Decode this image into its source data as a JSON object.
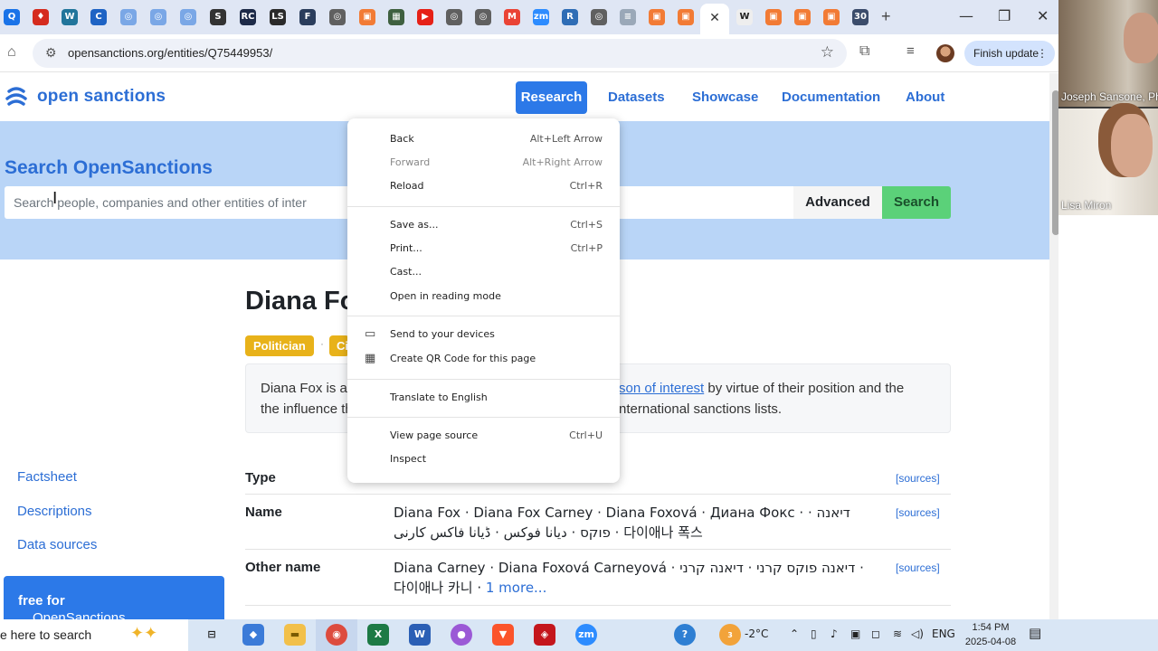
{
  "browser": {
    "tabs": [
      {
        "icon": "search-icon",
        "color": "#1a73e8",
        "glyph": "Q"
      },
      {
        "icon": "maple-leaf-icon",
        "color": "#d52b1e",
        "glyph": "♦"
      },
      {
        "icon": "wordpress-icon",
        "color": "#21759b",
        "glyph": "W"
      },
      {
        "icon": "c-icon",
        "color": "#1e63c4",
        "glyph": "C"
      },
      {
        "icon": "globe-icon",
        "color": "#7aa7e6",
        "glyph": "◎"
      },
      {
        "icon": "globe-icon",
        "color": "#7aa7e6",
        "glyph": "◎"
      },
      {
        "icon": "globe-icon",
        "color": "#7aa7e6",
        "glyph": "◎"
      },
      {
        "icon": "s-icon",
        "color": "#333333",
        "glyph": "S"
      },
      {
        "icon": "rc-icon",
        "color": "#1d2a48",
        "glyph": "RC"
      },
      {
        "icon": "ls-icon",
        "color": "#2a2a2a",
        "glyph": "LS"
      },
      {
        "icon": "f-icon",
        "color": "#2a3d5c",
        "glyph": "F"
      },
      {
        "icon": "globe-icon",
        "color": "#606060",
        "glyph": "◎"
      },
      {
        "icon": "bookmark-icon",
        "color": "#f27b35",
        "glyph": "▣"
      },
      {
        "icon": "image-icon",
        "color": "#3f6040",
        "glyph": "▦"
      },
      {
        "icon": "youtube-icon",
        "color": "#e62117",
        "glyph": "▶"
      },
      {
        "icon": "globe-icon",
        "color": "#606060",
        "glyph": "◎"
      },
      {
        "icon": "globe-icon",
        "color": "#606060",
        "glyph": "◎"
      },
      {
        "icon": "gmail-icon",
        "color": "#ea4335",
        "glyph": "M"
      },
      {
        "icon": "zoom-icon",
        "color": "#2d8cff",
        "glyph": "zm"
      },
      {
        "icon": "r-icon",
        "color": "#2f6db5",
        "glyph": "R"
      },
      {
        "icon": "globe-icon",
        "color": "#606060",
        "glyph": "◎"
      },
      {
        "icon": "news-icon",
        "color": "#9aa8b8",
        "glyph": "≡"
      },
      {
        "icon": "bookmark-icon",
        "color": "#f27b35",
        "glyph": "▣"
      },
      {
        "icon": "bookmark-icon",
        "color": "#f27b35",
        "glyph": "▣"
      }
    ],
    "active_tab_close": "✕",
    "tabs_after": [
      {
        "icon": "wikipedia-icon",
        "color": "#eeeeee",
        "glyph": "W"
      },
      {
        "icon": "bookmark-icon",
        "color": "#f27b35",
        "glyph": "▣"
      },
      {
        "icon": "bookmark-icon",
        "color": "#f27b35",
        "glyph": "▣"
      },
      {
        "icon": "bookmark-icon",
        "color": "#f27b35",
        "glyph": "▣"
      },
      {
        "icon": "counter-icon",
        "color": "#3b4c6b",
        "glyph": "30"
      }
    ],
    "new_tab": "+",
    "url": "opensanctions.org/entities/Q75449953/",
    "finish_update": "Finish update",
    "window_controls": {
      "minimize": "—",
      "maximize": "❐",
      "close": "✕"
    }
  },
  "site": {
    "logo_text": "open sanctions",
    "nav": {
      "research": "Research",
      "datasets": "Datasets",
      "showcase": "Showcase",
      "documentation": "Documentation",
      "about": "About"
    },
    "hero_title": "Search OpenSanctions",
    "search_placeholder": "Search people, companies and other entities of inter",
    "advanced": "Advanced",
    "search": "Search",
    "entity_title": "Diana Fo",
    "badges": [
      "Politician",
      "Ci"
    ],
    "summary": {
      "line1_left": "Diana Fox is a",
      "line2_left": "the influence they",
      "line1_right_link": "son of interest",
      "line1_right_rest": " by virtue of their position and the",
      "line2_right": "nternational sanctions lists."
    },
    "sidebar": {
      "factsheet": "Factsheet",
      "descriptions": "Descriptions",
      "data_sources": "Data sources",
      "promo_prefix": "OpenSanctions is ",
      "promo_bold": "free for"
    },
    "rows": {
      "type_label": "Type",
      "name_label": "Name",
      "name_value": "Diana Fox · Diana Fox Carney · Diana Foxová · Диана Фокс · · דיאנה פוקס · ديانا فوكس · ڈیانا فاکس کارنی · 다이애나 폭스",
      "other_label": "Other name",
      "other_value": "Diana Carney · Diana Foxová Carneyová · דיאנה פוקס קרני · דיאנה קרני · 다이애나 카니 · ",
      "other_more": "1 more...",
      "sources": "[sources]"
    }
  },
  "context_menu": {
    "back": "Back",
    "back_sc": "Alt+Left Arrow",
    "forward": "Forward",
    "forward_sc": "Alt+Right Arrow",
    "reload": "Reload",
    "reload_sc": "Ctrl+R",
    "save": "Save as...",
    "save_sc": "Ctrl+S",
    "print": "Print...",
    "print_sc": "Ctrl+P",
    "cast": "Cast...",
    "reading": "Open in reading mode",
    "send": "Send to your devices",
    "qr": "Create QR Code for this page",
    "translate": "Translate to English",
    "source": "View page source",
    "source_sc": "Ctrl+U",
    "inspect": "Inspect"
  },
  "video": {
    "participant1": "Joseph Sansone, Ph",
    "participant2": "Lisa Miron"
  },
  "taskbar": {
    "search_text": "e here to search",
    "weather": "-2°C",
    "lang": "ENG",
    "time": "1:54 PM",
    "date": "2025-04-08",
    "weather_badge": "3"
  }
}
